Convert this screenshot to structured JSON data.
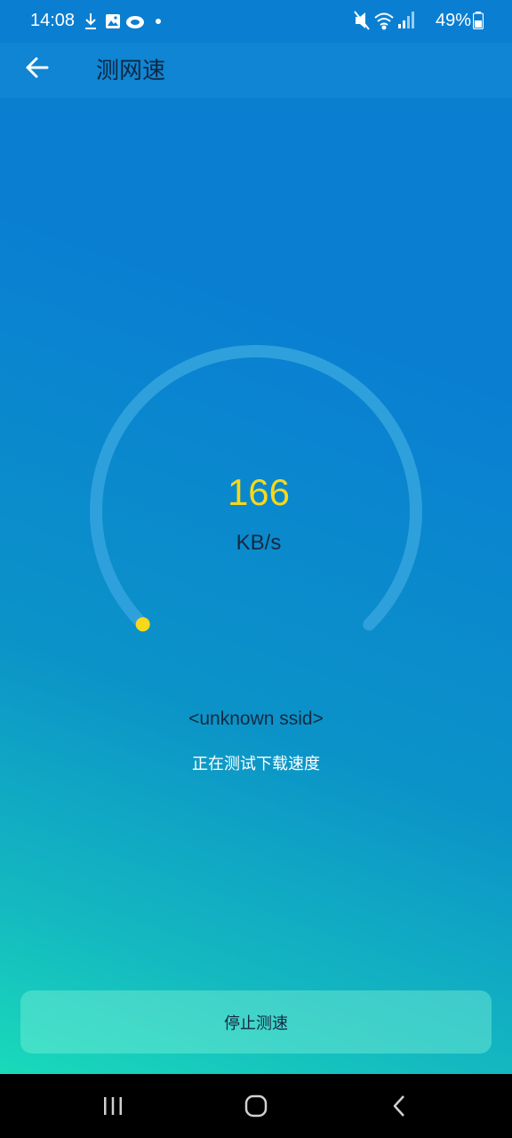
{
  "status_bar": {
    "time": "14:08",
    "battery_percent": "49%",
    "left_icons": [
      "download-icon",
      "image-icon",
      "cloud-app-icon",
      "dot-icon"
    ],
    "right_icons": [
      "mute-icon",
      "wifi-icon",
      "signal-icon",
      "battery-icon"
    ]
  },
  "app_bar": {
    "title": "测网速",
    "back_icon": "back-arrow-icon"
  },
  "gauge": {
    "value": "166",
    "unit": "KB/s",
    "progress_fraction": 0.0,
    "colors": {
      "track": "#2ea0dc",
      "indicator": "#f7d81b",
      "value_text": "#f7d81b"
    }
  },
  "network": {
    "ssid": "<unknown ssid>",
    "status_text": "正在测试下载速度"
  },
  "actions": {
    "stop_label": "停止测速"
  },
  "nav_bar": {
    "icons": [
      "recent-apps-icon",
      "home-icon",
      "back-icon"
    ]
  },
  "colors": {
    "gradient_top": "#0a7fd2",
    "gradient_bottom": "#1be6b8",
    "text_dark": "#132a42"
  }
}
